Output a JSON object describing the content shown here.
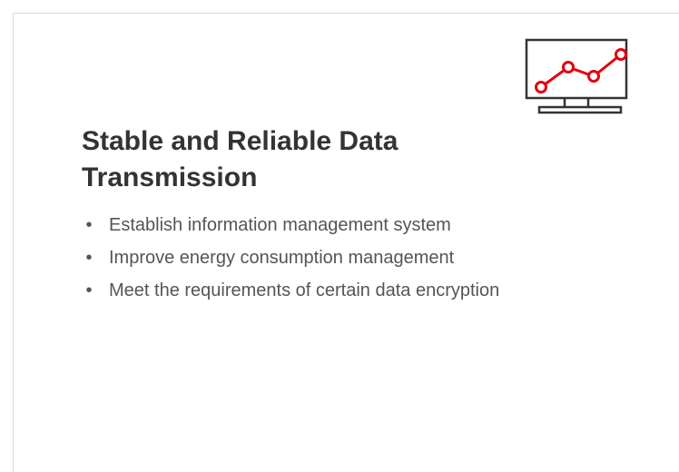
{
  "slide": {
    "title": "Stable and Reliable Data Transmission",
    "bullets": [
      "Establish information management system",
      "Improve energy consumption management",
      "Meet the requirements of certain data encryption"
    ],
    "bullet_glyph": "•"
  },
  "icon": {
    "name": "monitor-line-chart-icon",
    "accent_color": "#e3000f",
    "frame_color": "#333333"
  }
}
